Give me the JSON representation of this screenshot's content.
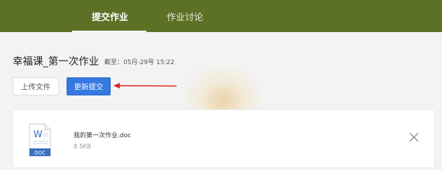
{
  "tabs": [
    {
      "label": "提交作业",
      "active": true
    },
    {
      "label": "作业讨论",
      "active": false
    }
  ],
  "assignment": {
    "title": "幸福课_第一次作业",
    "deadline": "截至：05月-29号  15:22"
  },
  "buttons": {
    "upload_label": "上传文件",
    "resubmit_label": "更新提交"
  },
  "file": {
    "name": "我的第一次作业.doc",
    "size": "8.5KB",
    "icon_letter": "W",
    "icon_type": "DOC",
    "icon": "word-doc-icon"
  },
  "colors": {
    "header_bg": "#5c7126",
    "primary_button": "#3478e0",
    "annotation_arrow": "#d9231f",
    "doc_icon_accent": "#3a6fc0"
  }
}
